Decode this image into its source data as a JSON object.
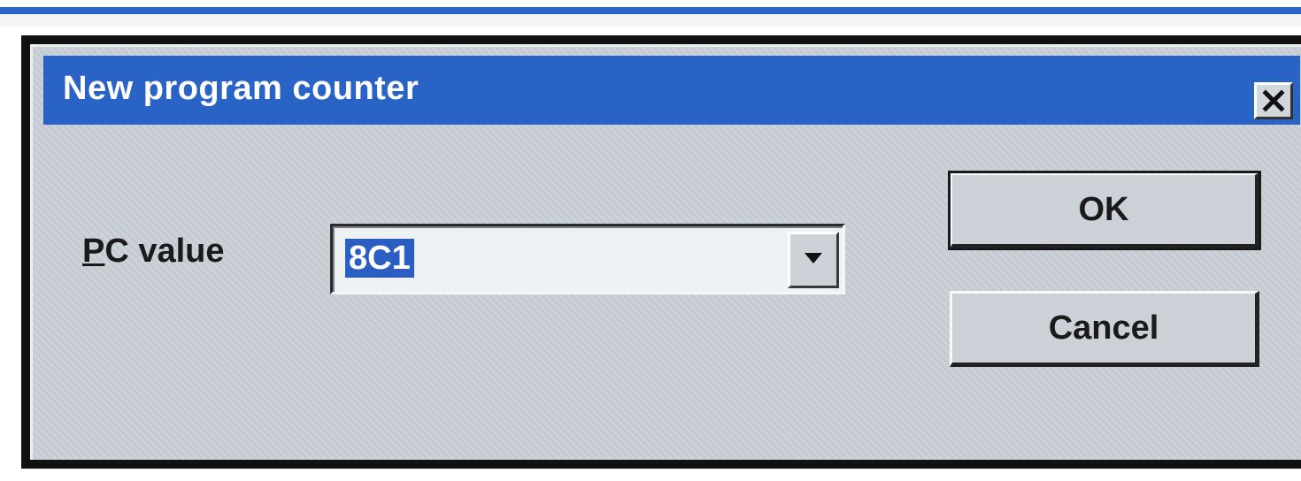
{
  "dialog": {
    "title": "New program counter",
    "close_icon": "close-icon"
  },
  "form": {
    "label_mnemonic": "P",
    "label_rest": "C value",
    "pc_value": "8C1",
    "dropdown_icon": "chevron-down-icon"
  },
  "buttons": {
    "ok_label": "OK",
    "cancel_label": "Cancel"
  },
  "colors": {
    "titlebar": "#2a63c6",
    "selection": "#2a5ec2",
    "face": "#c4cbd2"
  }
}
